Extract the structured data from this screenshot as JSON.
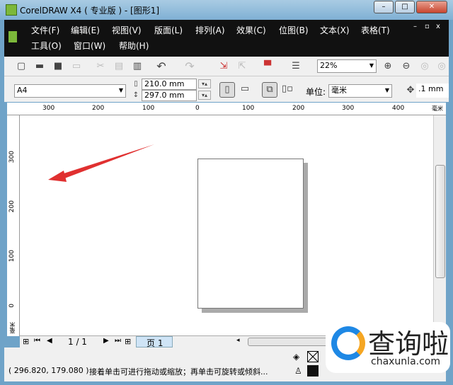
{
  "window": {
    "title": "CorelDRAW X4 ( 专业版 ) - [图形1]"
  },
  "menu": [
    "文件(F)",
    "编辑(E)",
    "视图(V)",
    "版面(L)",
    "排列(A)",
    "效果(C)",
    "位图(B)",
    "文本(X)",
    "表格(T)",
    "工具(O)",
    "窗口(W)",
    "帮助(H)"
  ],
  "toolbar": {
    "zoom": "22%"
  },
  "propbar": {
    "paper": "A4",
    "width": "210.0 mm",
    "height": "297.0 mm",
    "unit_label": "单位:",
    "unit": "毫米",
    "nudge": ".1 mm"
  },
  "ruler_h": [
    "300",
    "200",
    "100",
    "0",
    "100",
    "200",
    "300",
    "400",
    "毫米"
  ],
  "ruler_v": [
    "300",
    "200",
    "100",
    "0",
    "毫米"
  ],
  "pagenav": {
    "count": "1 / 1",
    "tab": "页 1"
  },
  "status": {
    "coords": "( 296.820, 179.080 )",
    "hint": "接着单击可进行拖动或缩放；再单击可旋转或倾斜..."
  },
  "watermark": {
    "name": "查询啦",
    "url": "chaxunla.com"
  },
  "colors": {
    "arrow": "#e03030",
    "accent": "#1e88e5"
  }
}
